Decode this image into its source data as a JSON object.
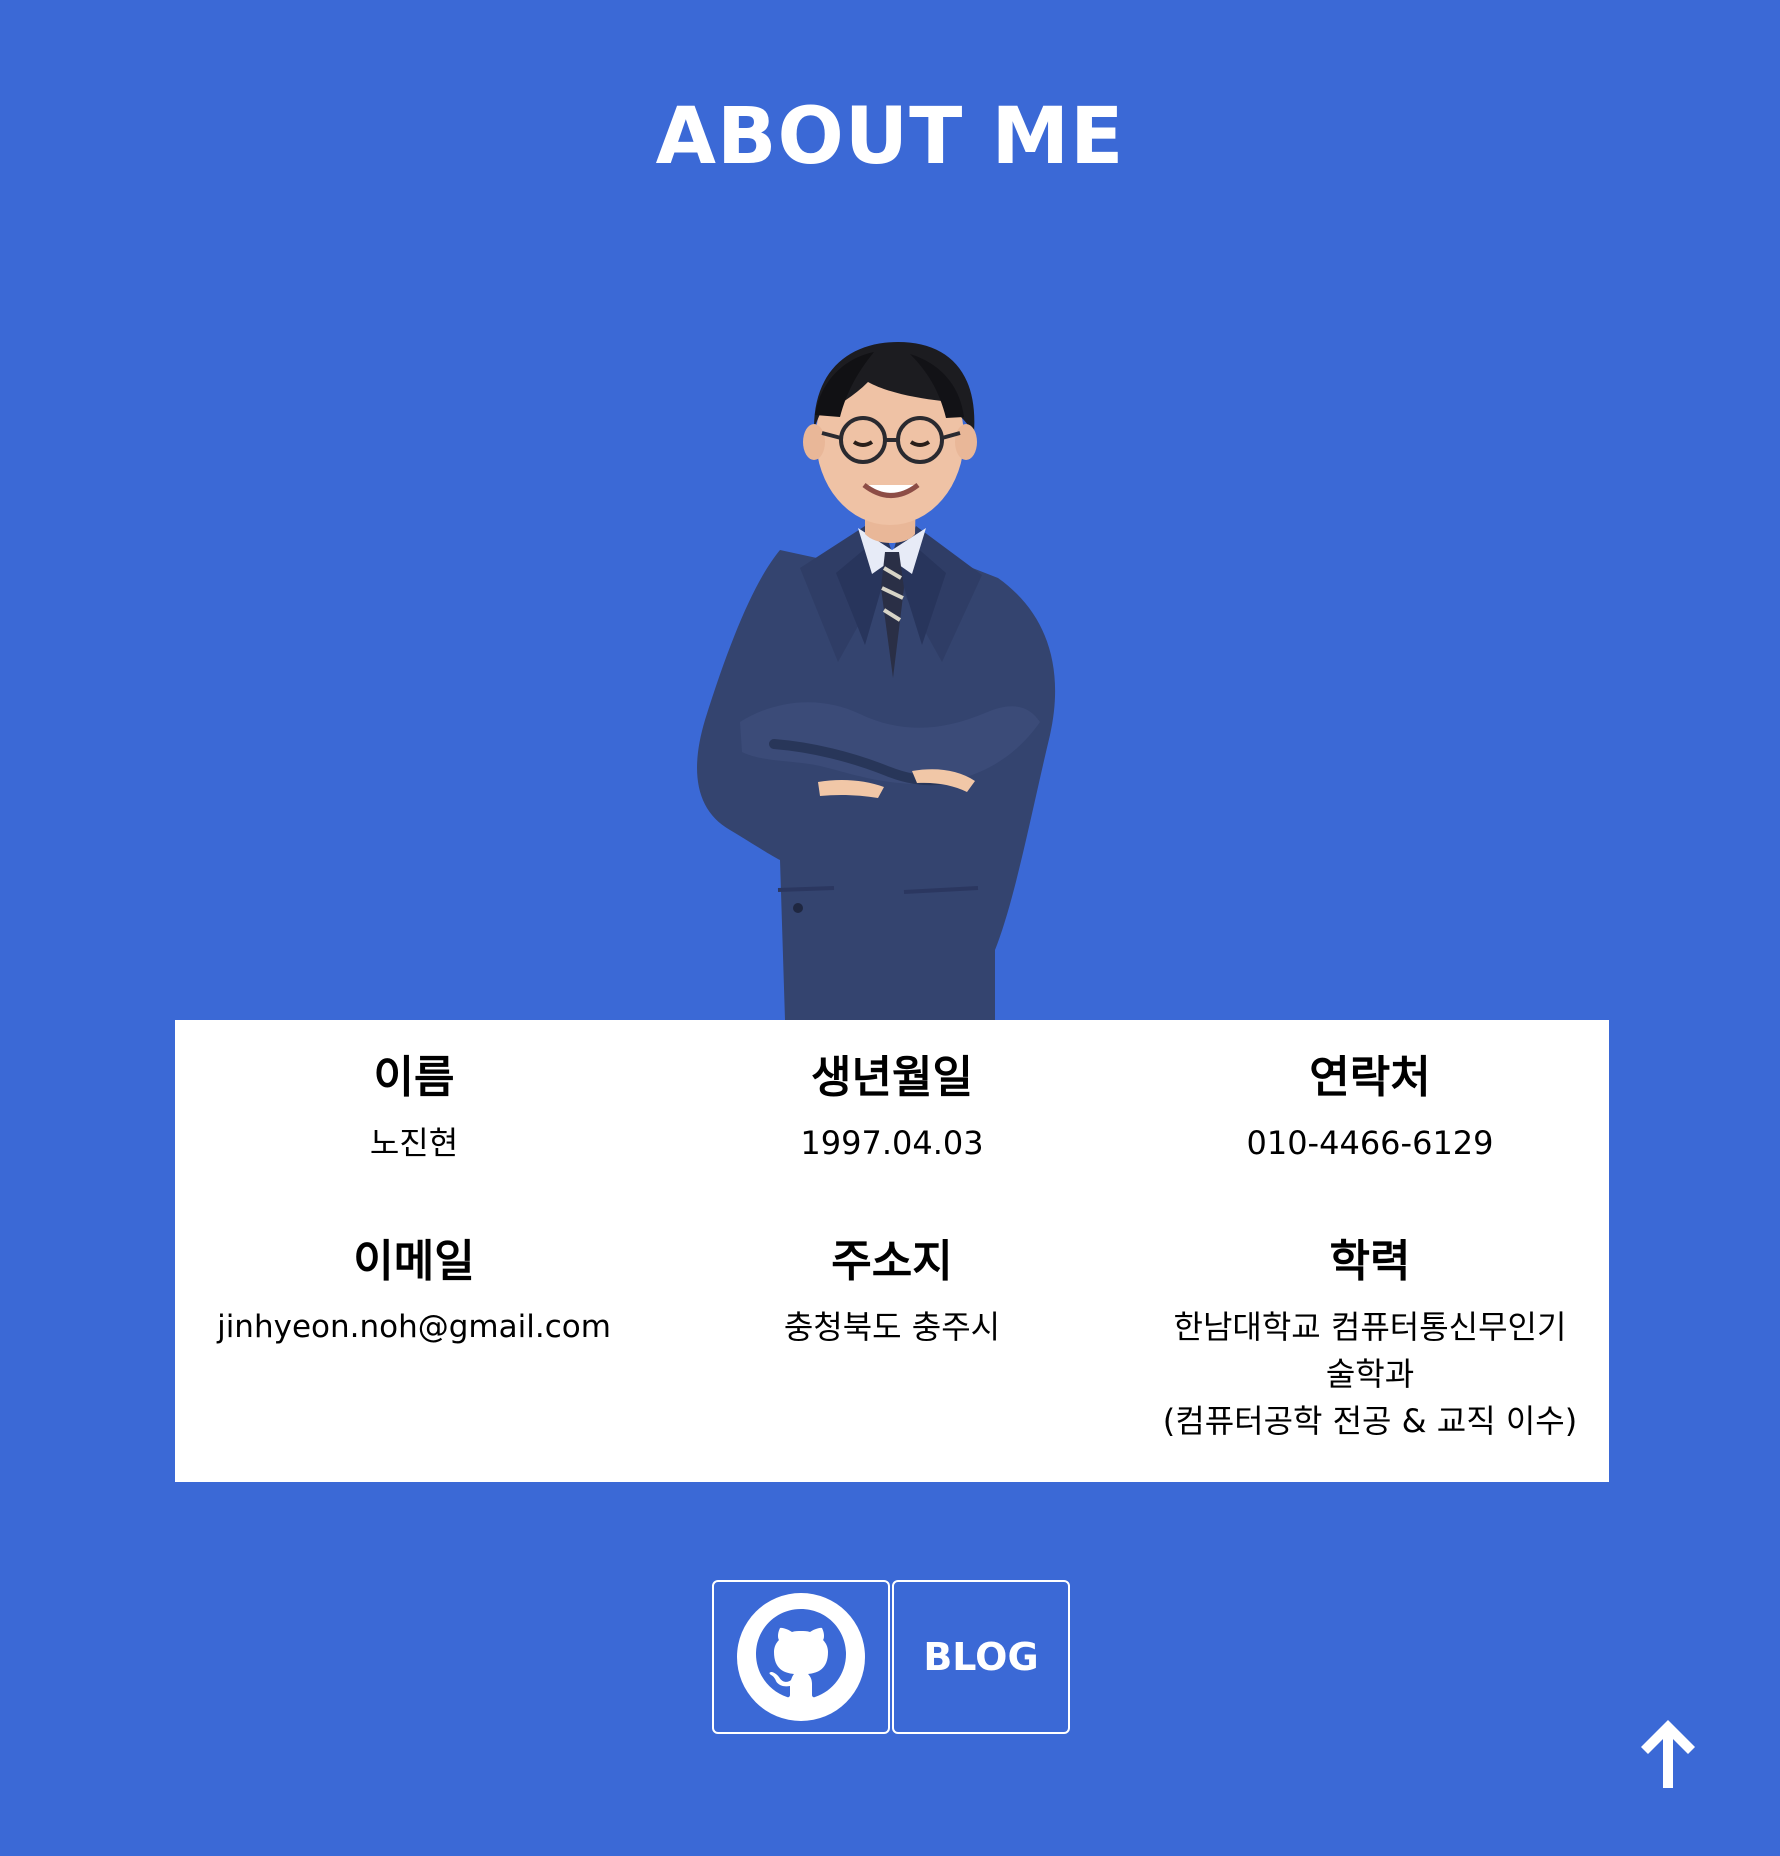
{
  "page": {
    "title": "ABOUT ME",
    "background_color": "#3b69d6",
    "card_color": "#ffffff"
  },
  "profile": {
    "portrait_icon": "person-portrait-icon",
    "info": [
      {
        "label": "이름",
        "value": "노진현"
      },
      {
        "label": "생년월일",
        "value": "1997.04.03"
      },
      {
        "label": "연락처",
        "value": "010-4466-6129"
      },
      {
        "label": "이메일",
        "value": "jinhyeon.noh@gmail.com"
      },
      {
        "label": "주소지",
        "value": "충청북도 충주시"
      },
      {
        "label": "학력",
        "value_lines": [
          "한남대학교 컴퓨터통신무인기",
          "술학과",
          "(컴퓨터공학 전공 & 교직 이수)"
        ]
      }
    ]
  },
  "links": {
    "github_icon": "github-icon",
    "blog_label": "BLOG"
  },
  "navigation": {
    "scroll_top_icon": "arrow-up-icon"
  }
}
